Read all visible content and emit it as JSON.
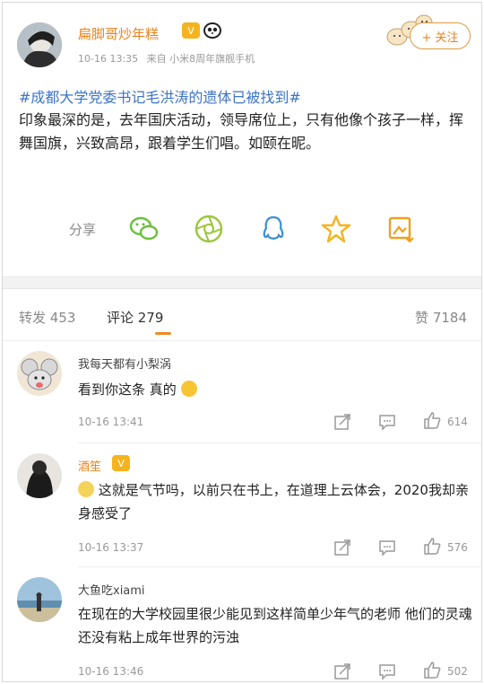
{
  "post": {
    "username": "扁脚哥炒年糕",
    "crown_badge": "V",
    "time": "10-16 13:35",
    "source": "来自 小米8周年旗舰手机",
    "follow_label": "+ 关注",
    "hashtag": "#成都大学党委书记毛洪涛的遗体已被找到#",
    "body": "印象最深的是，去年国庆活动，领导席位上，只有他像个孩子一样，挥舞国旗，兴致高昂，跟着学生们唱。如颐在昵。",
    "share_label": "分享",
    "share_icons": [
      "wechat-icon",
      "moments-icon",
      "qq-icon",
      "favorite-star-icon",
      "image-save-icon"
    ]
  },
  "tabs": {
    "repost": "转发 453",
    "comments": "评论 279",
    "likes": "赞 7184"
  },
  "comments": [
    {
      "name": "我每天都有小梨涡",
      "text": "看到你这条 真的",
      "time": "10-16 13:41",
      "likes": "614"
    },
    {
      "name": "酒笙",
      "text": "这就是气节吗，以前只在书上，在道理上云体会，2020我却亲身感受了",
      "time": "10-16 13:37",
      "likes": "576"
    },
    {
      "name": "大鱼吃xiami",
      "text": "在现在的大学校园里很少能见到这样简单少年气的老师 他们的灵魂还没有粘上成年世界的污浊",
      "time": "10-16 13:46",
      "likes": "502"
    }
  ],
  "colors": {
    "accent_orange": "#e8831f",
    "hashtag_blue": "#3d74c6",
    "icon_green": "#6cbf3a",
    "icon_blue": "#3a8fd6",
    "icon_star": "#f5b41f"
  }
}
